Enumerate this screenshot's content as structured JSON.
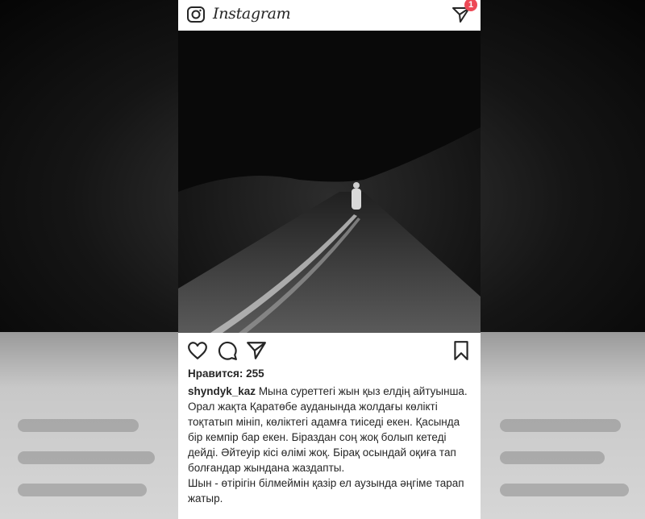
{
  "app": {
    "brand": "Instagram"
  },
  "header": {
    "dm_badge_count": "1"
  },
  "post": {
    "likes_text": "Нравится: 255",
    "username": "shyndyk_kaz",
    "caption_first": "Мына суреттегі жын қыз елдің айтуынша. Орал жақта Қаратөбе ауданында жолдағы көлікті тоқтатып мініп, көліктегі адамға тиіседі екен. Қасында бір кемпір бар екен. Біраздан соң жоқ болып кетеді дейді. Әйтеуір кісі өлімі жоқ. Бірақ осындай оқиға тап болғандар жынданa жаздапты.",
    "caption_second": "Шын - өтірігін білмеймін қазір ел аузында  әңгіме тарап жатыр."
  },
  "icons": {
    "camera": "camera-icon",
    "direct": "paper-plane-icon",
    "like": "heart-icon",
    "comment": "comment-icon",
    "share": "share-icon",
    "save": "bookmark-icon"
  },
  "colors": {
    "badge": "#ed4956",
    "text": "#262626"
  }
}
